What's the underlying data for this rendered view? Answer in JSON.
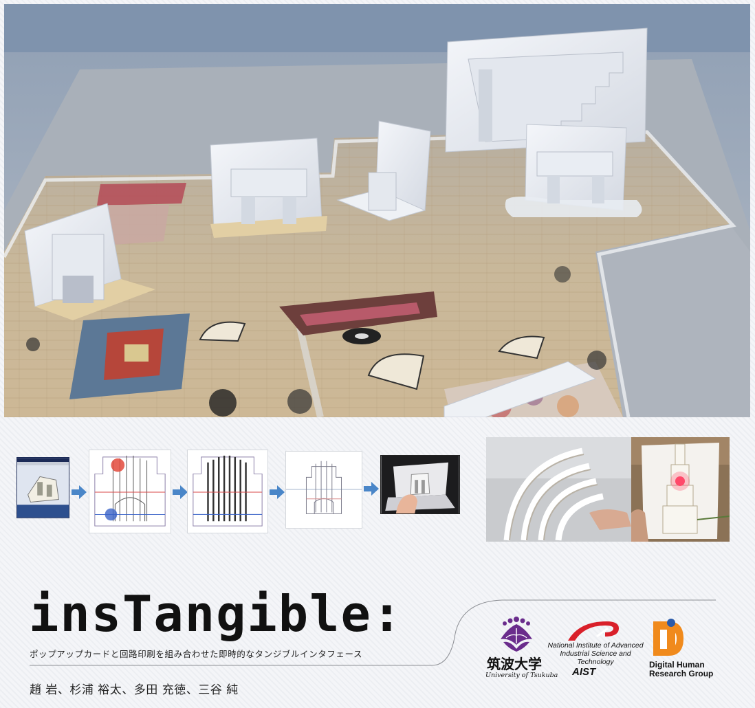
{
  "title": "insTangible:",
  "subtitle": "ポップアップカードと回路印刷を組み合わせた即時的なタンジブルインタフェース",
  "authors": "趙 岩、杉浦 裕太、多田 充徳、三谷 純",
  "logos": {
    "tsukuba": {
      "name_jp": "筑波大学",
      "name_en": "University of Tsukuba",
      "icon": "paulownia-crest-icon"
    },
    "aist": {
      "name": "National Institute of Advanced Industrial Science and Technology",
      "label": "AIST",
      "icon": "aist-swoosh-icon"
    },
    "dhrg": {
      "name": "Digital Human Research Group",
      "icon": "digital-human-icon"
    }
  },
  "colors": {
    "arrow": "#4a86c8",
    "aist_red": "#d9202a",
    "tsukuba_purple": "#6a2c8c",
    "dh_orange": "#f08a1c",
    "dh_blue": "#2a5aa8"
  }
}
